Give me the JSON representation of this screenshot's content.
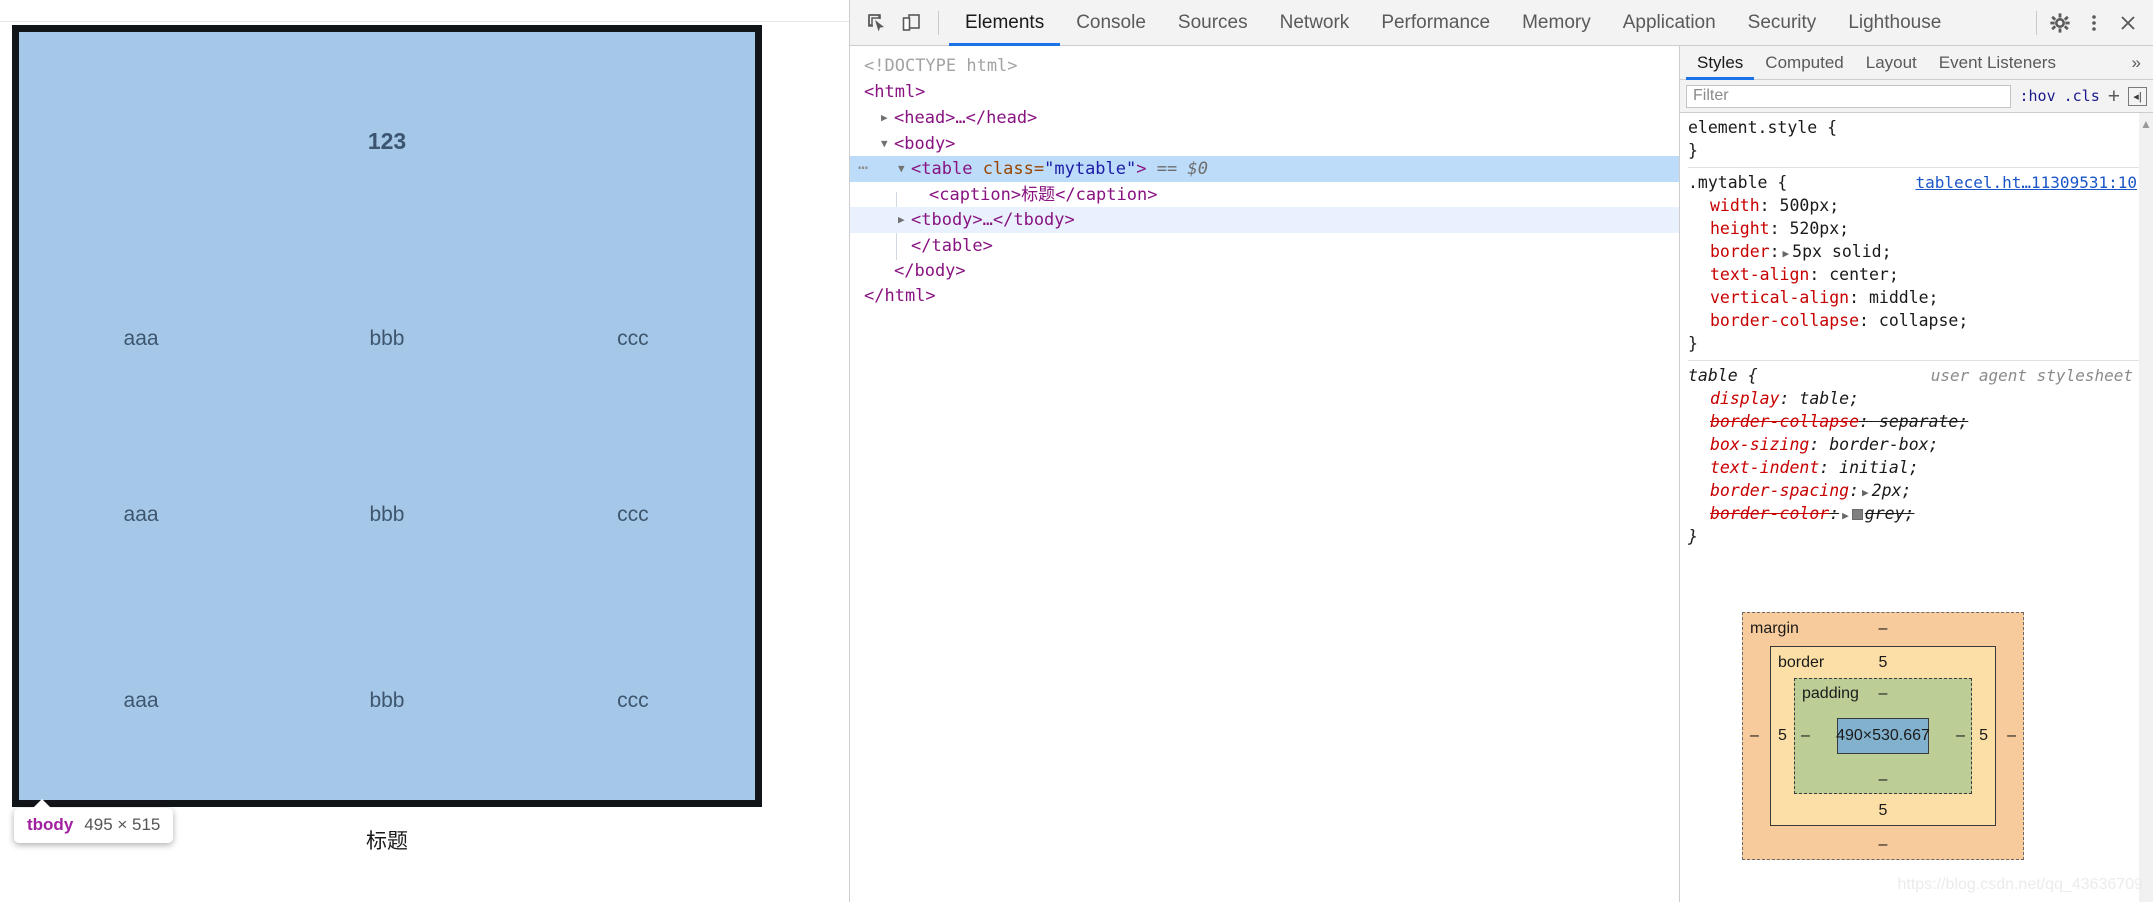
{
  "page": {
    "table": {
      "header_cell": "123",
      "caption": "标题",
      "rows": [
        {
          "cells": [
            "aaa",
            "bbb",
            "ccc"
          ]
        },
        {
          "cells": [
            "aaa",
            "bbb",
            "ccc"
          ]
        },
        {
          "cells": [
            "aaa",
            "bbb",
            "ccc"
          ]
        }
      ]
    },
    "node_tooltip": {
      "tag": "tbody",
      "dimensions": "495 × 515"
    }
  },
  "devtools": {
    "icons": {
      "inspect": "inspect-element-icon",
      "device": "device-toolbar-icon",
      "settings": "gear-icon",
      "more": "kebab-menu-icon",
      "close": "close-icon"
    },
    "tabs": [
      {
        "label": "Elements",
        "active": true
      },
      {
        "label": "Console",
        "active": false
      },
      {
        "label": "Sources",
        "active": false
      },
      {
        "label": "Network",
        "active": false
      },
      {
        "label": "Performance",
        "active": false
      },
      {
        "label": "Memory",
        "active": false
      },
      {
        "label": "Application",
        "active": false
      },
      {
        "label": "Security",
        "active": false
      },
      {
        "label": "Lighthouse",
        "active": false
      }
    ],
    "dom": {
      "lines": [
        {
          "text": "<!DOCTYPE html>"
        },
        {
          "text": "<html>"
        },
        {
          "text": "<head>…</head>"
        },
        {
          "text": "<body>"
        },
        {
          "tag": "table",
          "attr_name": "class",
          "attr_value": "\"mytable\"",
          "suffix": "== $0"
        },
        {
          "text": "<caption>标题</caption>"
        },
        {
          "text": "<tbody>…</tbody>"
        },
        {
          "text": "</table>"
        },
        {
          "text": "</body>"
        },
        {
          "text": "</html>"
        }
      ]
    },
    "styles": {
      "tabs": [
        {
          "label": "Styles",
          "active": true
        },
        {
          "label": "Computed",
          "active": false
        },
        {
          "label": "Layout",
          "active": false
        },
        {
          "label": "Event Listeners",
          "active": false
        }
      ],
      "more_label": "»",
      "filter_placeholder": "Filter",
      "filter_value": "",
      "toggle_hov": ":hov",
      "toggle_cls": ".cls",
      "add_rule": "+",
      "rules": [
        {
          "selector": "element.style {",
          "source": "",
          "note": "",
          "declarations": [],
          "close": "}"
        },
        {
          "selector": ".mytable {",
          "source": "tablecel.ht…11309531:10",
          "note": "",
          "declarations": [
            {
              "property": "width",
              "value": "500px;",
              "strike": false,
              "twirl": false
            },
            {
              "property": "height",
              "value": "520px;",
              "strike": false,
              "twirl": false
            },
            {
              "property": "border",
              "value": "5px solid;",
              "strike": false,
              "twirl": true
            },
            {
              "property": "text-align",
              "value": "center;",
              "strike": false,
              "twirl": false
            },
            {
              "property": "vertical-align",
              "value": "middle;",
              "strike": false,
              "twirl": false
            },
            {
              "property": "border-collapse",
              "value": "collapse;",
              "strike": false,
              "twirl": false
            }
          ],
          "close": "}"
        },
        {
          "selector": "table {",
          "source": "",
          "note": "user agent stylesheet",
          "ua": true,
          "declarations": [
            {
              "property": "display",
              "value": "table;",
              "strike": false,
              "twirl": false
            },
            {
              "property": "border-collapse",
              "value": "separate;",
              "strike": true,
              "twirl": false
            },
            {
              "property": "box-sizing",
              "value": "border-box;",
              "strike": false,
              "twirl": false
            },
            {
              "property": "text-indent",
              "value": "initial;",
              "strike": false,
              "twirl": false
            },
            {
              "property": "border-spacing",
              "value": "2px;",
              "strike": false,
              "twirl": true
            },
            {
              "property": "border-color",
              "value": "grey;",
              "strike": true,
              "twirl": true,
              "swatch": true
            }
          ],
          "close": "}"
        }
      ],
      "box_model": {
        "margin_label": "margin",
        "border_label": "border",
        "padding_label": "padding",
        "content_size": "490×530.667",
        "margin_top": "–",
        "margin_right": "–",
        "margin_bottom": "–",
        "margin_left": "–",
        "border_top": "5",
        "border_right": "5",
        "border_bottom": "5",
        "border_left": "5",
        "padding_top": "–",
        "padding_right": "–",
        "padding_bottom": "–",
        "padding_left": "–"
      }
    }
  },
  "watermark": "https://blog.csdn.net/qq_43636709"
}
